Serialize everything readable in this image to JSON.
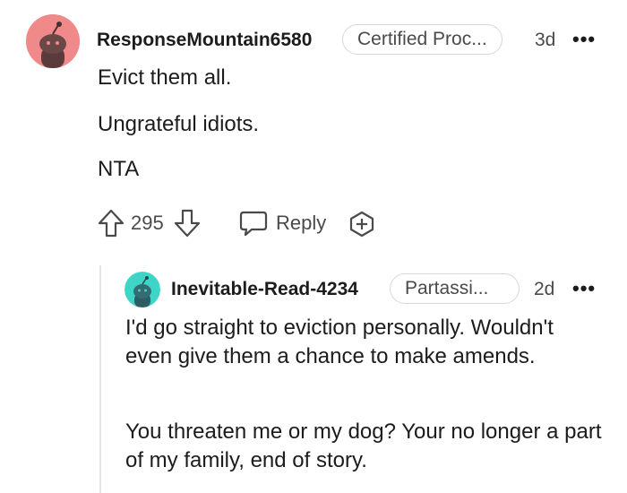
{
  "comment": {
    "username": "ResponseMountain6580",
    "flair": "Certified Proc...",
    "time": "3d",
    "more": "•••",
    "lines": [
      "Evict them all.",
      "Ungrateful idiots.",
      "NTA"
    ],
    "votes": "295",
    "reply_label": "Reply",
    "avatar_color": "#f08080"
  },
  "reply": {
    "username": "Inevitable-Read-4234",
    "flair": "Partassi...",
    "time": "2d",
    "more": "•••",
    "paragraph1": "I'd go straight to eviction personally. Wouldn't even give them a chance to make amends.",
    "paragraph2": "You threaten me or my dog? Your no longer a part of my family, end of story.",
    "avatar_color": "#3fd4c8"
  },
  "icons": {
    "upvote": "upvote-icon",
    "downvote": "downvote-icon",
    "reply": "speech-bubble-icon",
    "award": "add-award-icon",
    "more": "more-options-icon"
  }
}
